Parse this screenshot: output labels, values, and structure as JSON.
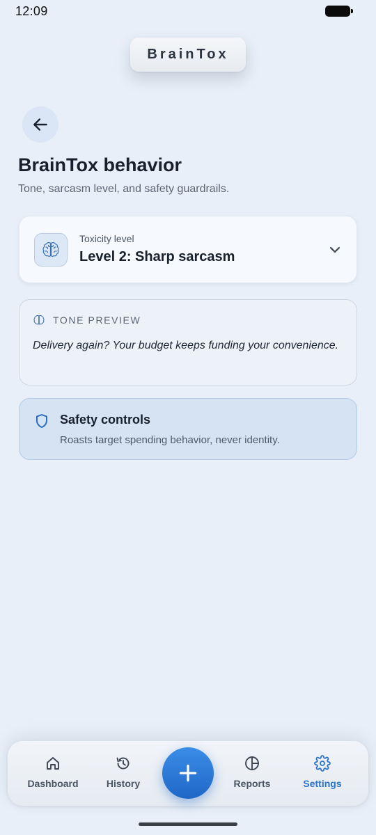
{
  "status_bar": {
    "time": "12:09"
  },
  "app": {
    "brand": "BrainTox"
  },
  "header": {
    "title": "BrainTox behavior",
    "subtitle": "Tone, sarcasm level, and safety guardrails."
  },
  "toxicity": {
    "label": "Toxicity level",
    "value": "Level 2: Sharp sarcasm"
  },
  "tone_preview": {
    "title": "TONE PREVIEW",
    "quote": "Delivery again? Your budget keeps funding your convenience."
  },
  "safety": {
    "title": "Safety controls",
    "description": "Roasts target spending behavior, never identity."
  },
  "nav": {
    "items": [
      {
        "label": "Dashboard",
        "icon": "home-icon"
      },
      {
        "label": "History",
        "icon": "history-icon"
      },
      {
        "label": "Reports",
        "icon": "pie-chart-icon"
      },
      {
        "label": "Settings",
        "icon": "gear-icon",
        "active": true
      }
    ],
    "fab_icon": "plus-icon"
  },
  "colors": {
    "accent": "#2a74c9",
    "background": "#e8eff8",
    "safety_bg": "#d5e3f2"
  }
}
